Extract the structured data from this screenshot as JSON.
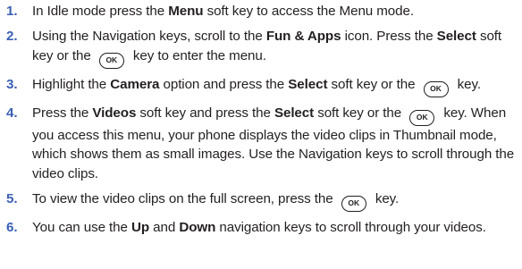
{
  "steps": [
    {
      "number": "1.",
      "segments": [
        {
          "t": "In Idle mode press the "
        },
        {
          "t": "Menu",
          "b": true
        },
        {
          "t": " soft key to access the Menu mode."
        }
      ]
    },
    {
      "number": "2.",
      "segments": [
        {
          "t": "Using the Navigation keys, scroll to the "
        },
        {
          "t": "Fun & Apps",
          "b": true
        },
        {
          "t": " icon. Press the "
        },
        {
          "t": "Select",
          "b": true
        },
        {
          "t": " soft key or the "
        },
        {
          "key": "OK"
        },
        {
          "t": " key to enter the menu."
        }
      ]
    },
    {
      "number": "3.",
      "segments": [
        {
          "t": "Highlight the "
        },
        {
          "t": "Camera",
          "b": true
        },
        {
          "t": " option and press the "
        },
        {
          "t": "Select",
          "b": true
        },
        {
          "t": " soft key or the "
        },
        {
          "key": "OK"
        },
        {
          "t": " key."
        }
      ]
    },
    {
      "number": "4.",
      "segments": [
        {
          "t": "Press the "
        },
        {
          "t": "Videos",
          "b": true
        },
        {
          "t": " soft key and press the "
        },
        {
          "t": "Select",
          "b": true
        },
        {
          "t": " soft key or the "
        },
        {
          "key": "OK"
        },
        {
          "t": " key. When you access this menu, your phone displays the video clips in Thumbnail mode, which shows them as small images. Use the Navigation keys to scroll through the video clips."
        }
      ]
    },
    {
      "number": "5.",
      "segments": [
        {
          "t": "To view the video clips on the full screen, press the "
        },
        {
          "key": "OK"
        },
        {
          "t": " key."
        }
      ]
    },
    {
      "number": "6.",
      "segments": [
        {
          "t": "You can use the "
        },
        {
          "t": "Up",
          "b": true
        },
        {
          "t": " and "
        },
        {
          "t": "Down",
          "b": true
        },
        {
          "t": " navigation keys to scroll through your videos."
        }
      ]
    }
  ]
}
